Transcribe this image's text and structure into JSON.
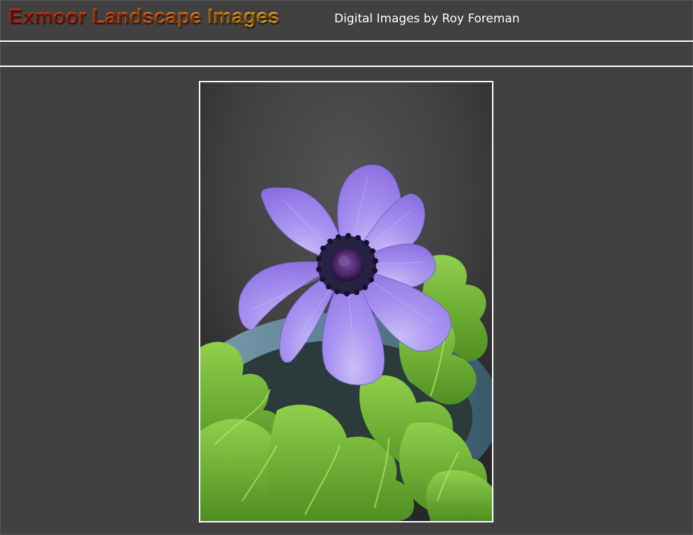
{
  "header": {
    "title": "Exmoor Landscape Images",
    "subtitle": "Digital Images by Roy Foreman"
  },
  "colors": {
    "background": "#414141",
    "divider": "#ffffff",
    "title_gradient_start": "#d81e10",
    "title_gradient_end": "#f6b21a",
    "subtitle": "#ffffff",
    "petal": "#9b86ec",
    "foliage": "#6fb83a"
  },
  "photo": {
    "subject_icon": "anemone-flower-photo"
  }
}
